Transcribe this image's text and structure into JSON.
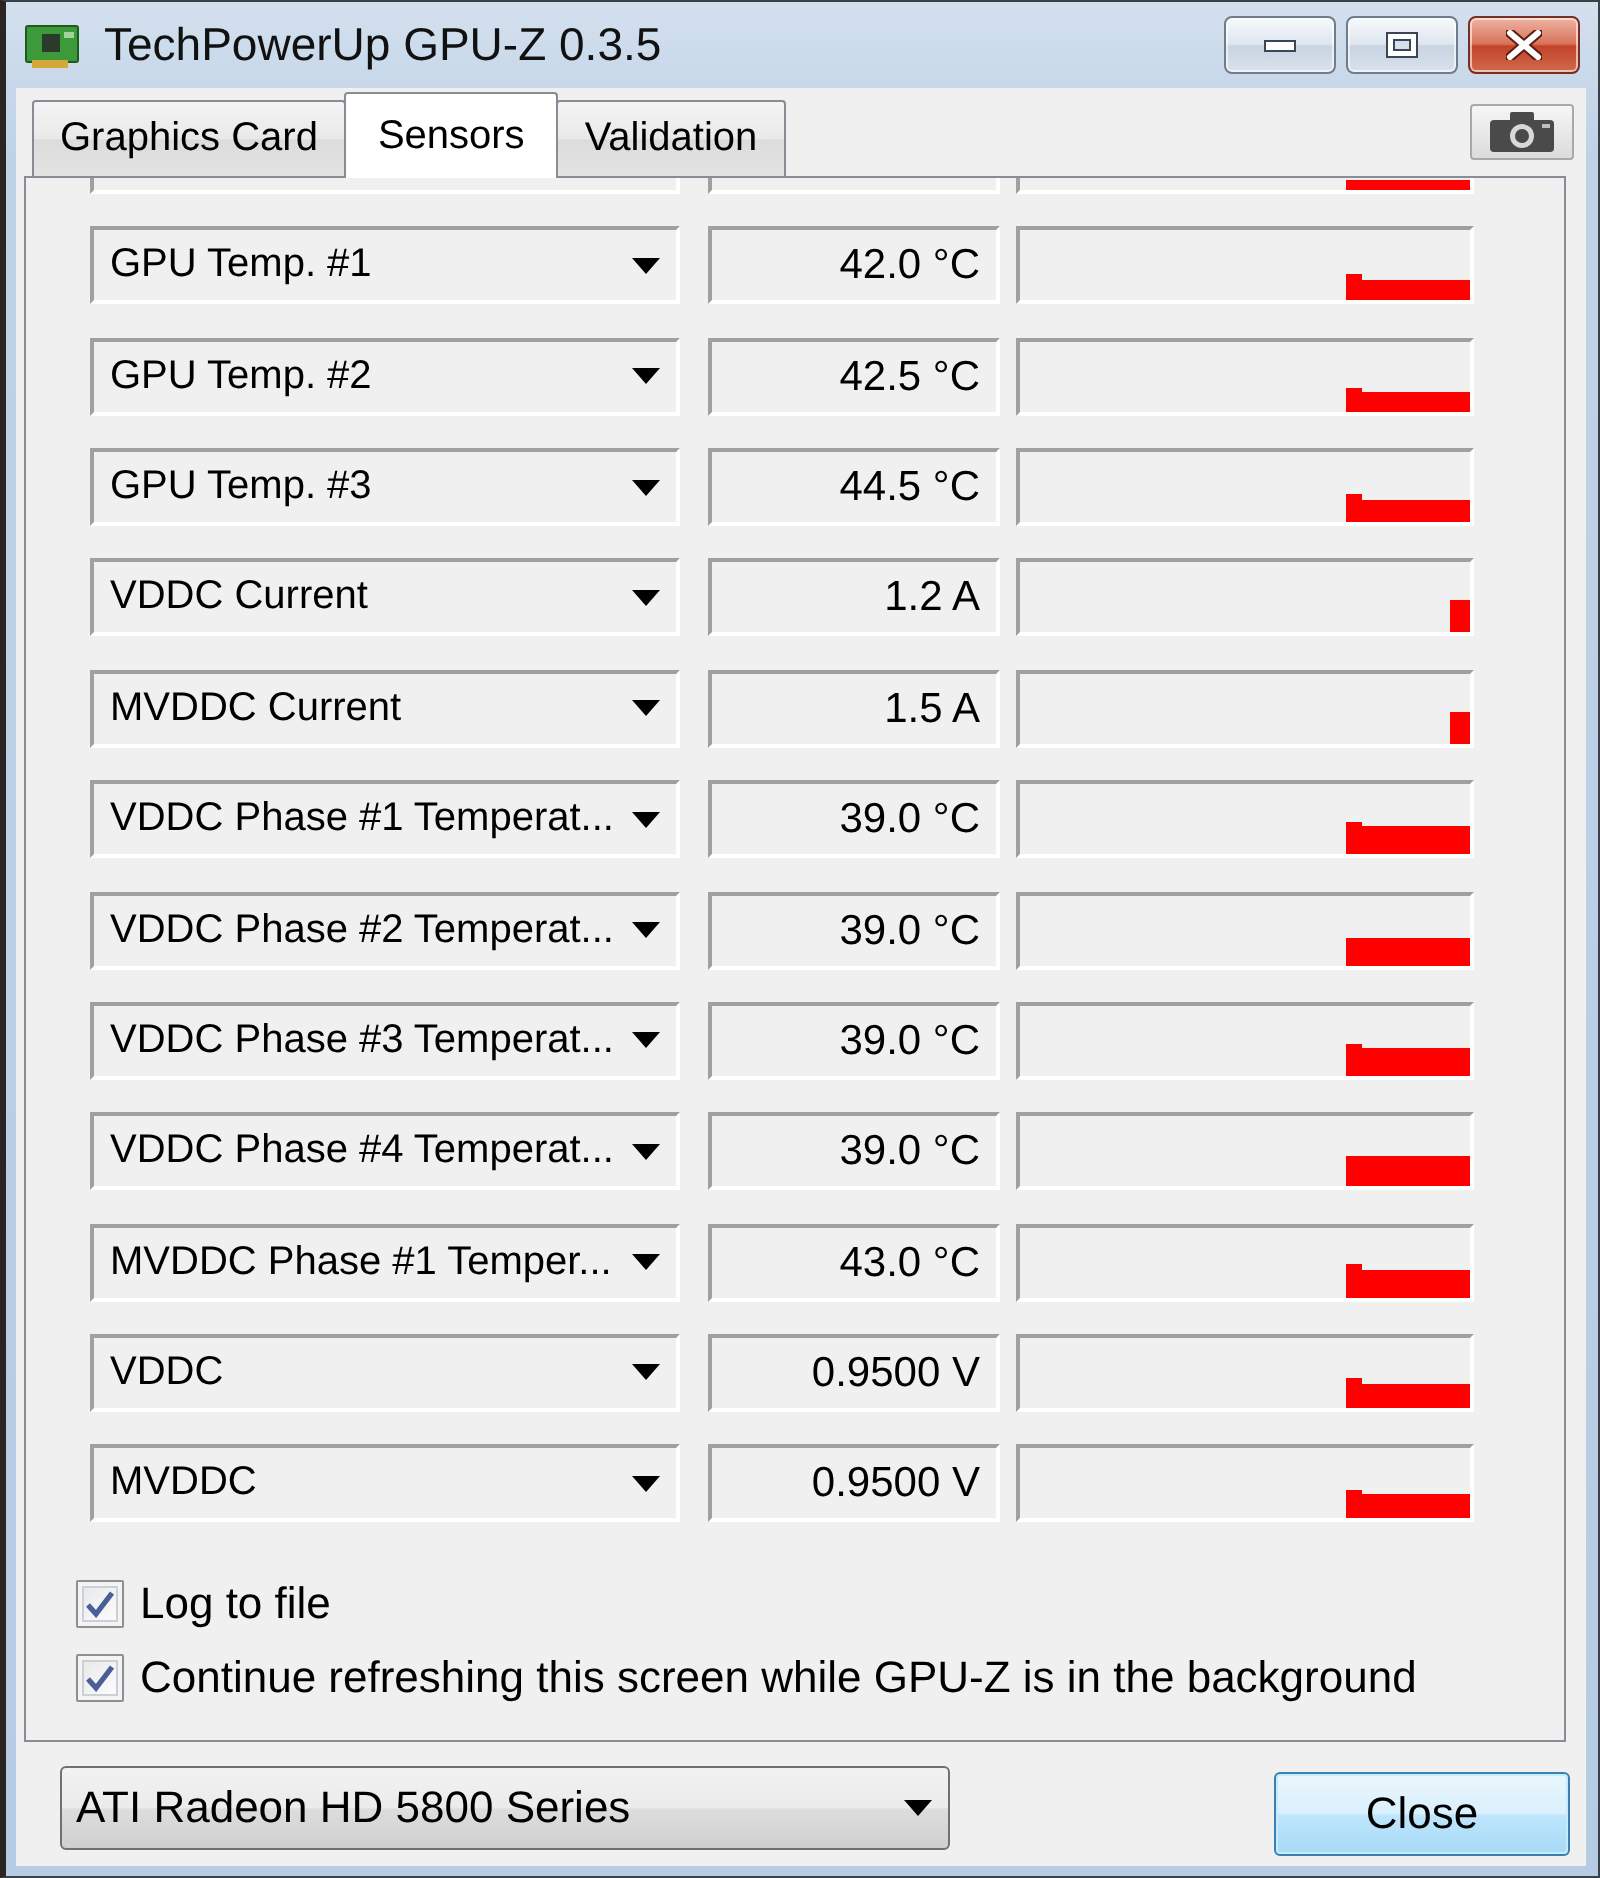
{
  "window": {
    "title": "TechPowerUp GPU-Z 0.3.5"
  },
  "tabs": [
    {
      "label": "Graphics Card",
      "selected": false
    },
    {
      "label": "Sensors",
      "selected": true
    },
    {
      "label": "Validation",
      "selected": false
    }
  ],
  "sensors": [
    {
      "name": "GPU Temp. #1",
      "value": "42.0 °C"
    },
    {
      "name": "GPU Temp. #2",
      "value": "42.5 °C"
    },
    {
      "name": "GPU Temp. #3",
      "value": "44.5 °C"
    },
    {
      "name": "VDDC Current",
      "value": "1.2 A"
    },
    {
      "name": "MVDDC Current",
      "value": "1.5 A"
    },
    {
      "name": "VDDC Phase #1 Temperat...",
      "value": "39.0 °C"
    },
    {
      "name": "VDDC Phase #2 Temperat...",
      "value": "39.0 °C"
    },
    {
      "name": "VDDC Phase #3 Temperat...",
      "value": "39.0 °C"
    },
    {
      "name": "VDDC Phase #4 Temperat...",
      "value": "39.0 °C"
    },
    {
      "name": "MVDDC Phase #1 Temper...",
      "value": "43.0 °C"
    },
    {
      "name": "VDDC",
      "value": "0.9500 V"
    },
    {
      "name": "MVDDC",
      "value": "0.9500 V"
    }
  ],
  "options": [
    {
      "label": "Log to file",
      "checked": true
    },
    {
      "label": "Continue refreshing this screen while GPU-Z is in the background",
      "checked": true
    }
  ],
  "footer": {
    "gpu_select": "ATI Radeon HD 5800 Series",
    "close_button": "Close"
  }
}
